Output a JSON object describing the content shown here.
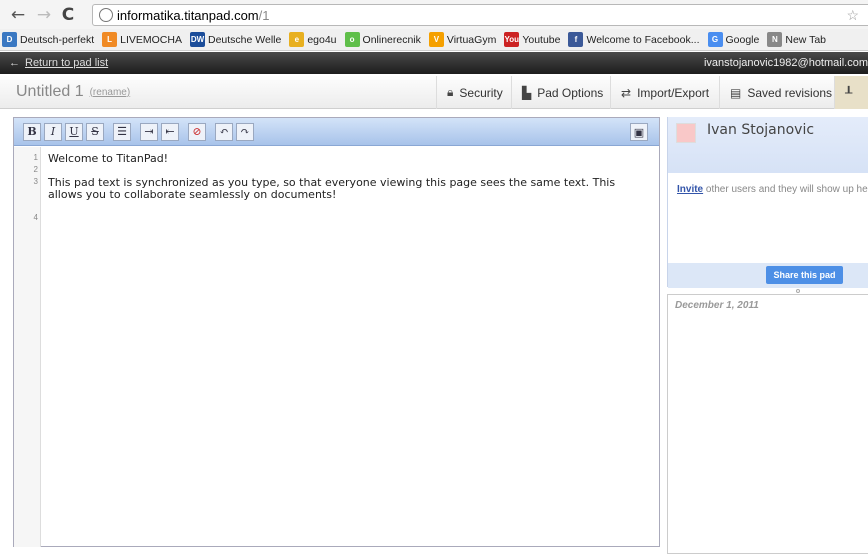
{
  "browser": {
    "url_host": "informatika.titanpad.com",
    "url_path": "/1",
    "bookmarks": [
      {
        "label": "Deutsch-perfekt",
        "color": "#3a78c2",
        "glyph": "D"
      },
      {
        "label": "LIVEMOCHA",
        "color": "#f08a24",
        "glyph": "L"
      },
      {
        "label": "Deutsche Welle",
        "color": "#1b4d9a",
        "glyph": "DW"
      },
      {
        "label": "ego4u",
        "color": "#e8b020",
        "glyph": "e"
      },
      {
        "label": "Onlinerecnik",
        "color": "#5fbf4a",
        "glyph": "o"
      },
      {
        "label": "VirtuaGym",
        "color": "#f5a000",
        "glyph": "V"
      },
      {
        "label": "Youtube",
        "color": "#cc2222",
        "glyph": "You"
      },
      {
        "label": "Welcome to Facebook...",
        "color": "#3b5998",
        "glyph": "f"
      },
      {
        "label": "Google",
        "color": "#4a8ef0",
        "glyph": "G"
      },
      {
        "label": "New Tab",
        "color": "#888888",
        "glyph": "N"
      }
    ]
  },
  "topbar": {
    "back_label": "Return to pad list",
    "user_email": "ivanstojanovic1982@hotmail.com"
  },
  "titlebar": {
    "title": "Untitled 1",
    "rename_label": "(rename)",
    "buttons": [
      {
        "label": "Security",
        "icon": "lock-icon"
      },
      {
        "label": "Pad Options",
        "icon": "document-icon"
      },
      {
        "label": "Import/Export",
        "icon": "swap-arrows-icon"
      },
      {
        "label": "Saved revisions",
        "icon": "floppy-icon"
      }
    ]
  },
  "editor": {
    "toolbar": [
      "B",
      "I",
      "U",
      "S",
      "list",
      "indent",
      "outdent",
      "clear",
      "undo",
      "redo",
      "save"
    ],
    "line_numbers": [
      "1",
      "2",
      "3",
      "4"
    ],
    "lines": [
      "Welcome to TitanPad!",
      "",
      "This pad text is synchronized as you type, so that everyone viewing this page sees the same text.  This allows you to collaborate seamlessly on documents!",
      ""
    ]
  },
  "users": {
    "name": "Ivan Stojanovic",
    "swatch_color": "#f9c8c8",
    "invite_link": "Invite",
    "invite_rest": " other users and they will show up here.",
    "share_label": "Share this pad"
  },
  "chat": {
    "date": "December 1, 2011"
  }
}
